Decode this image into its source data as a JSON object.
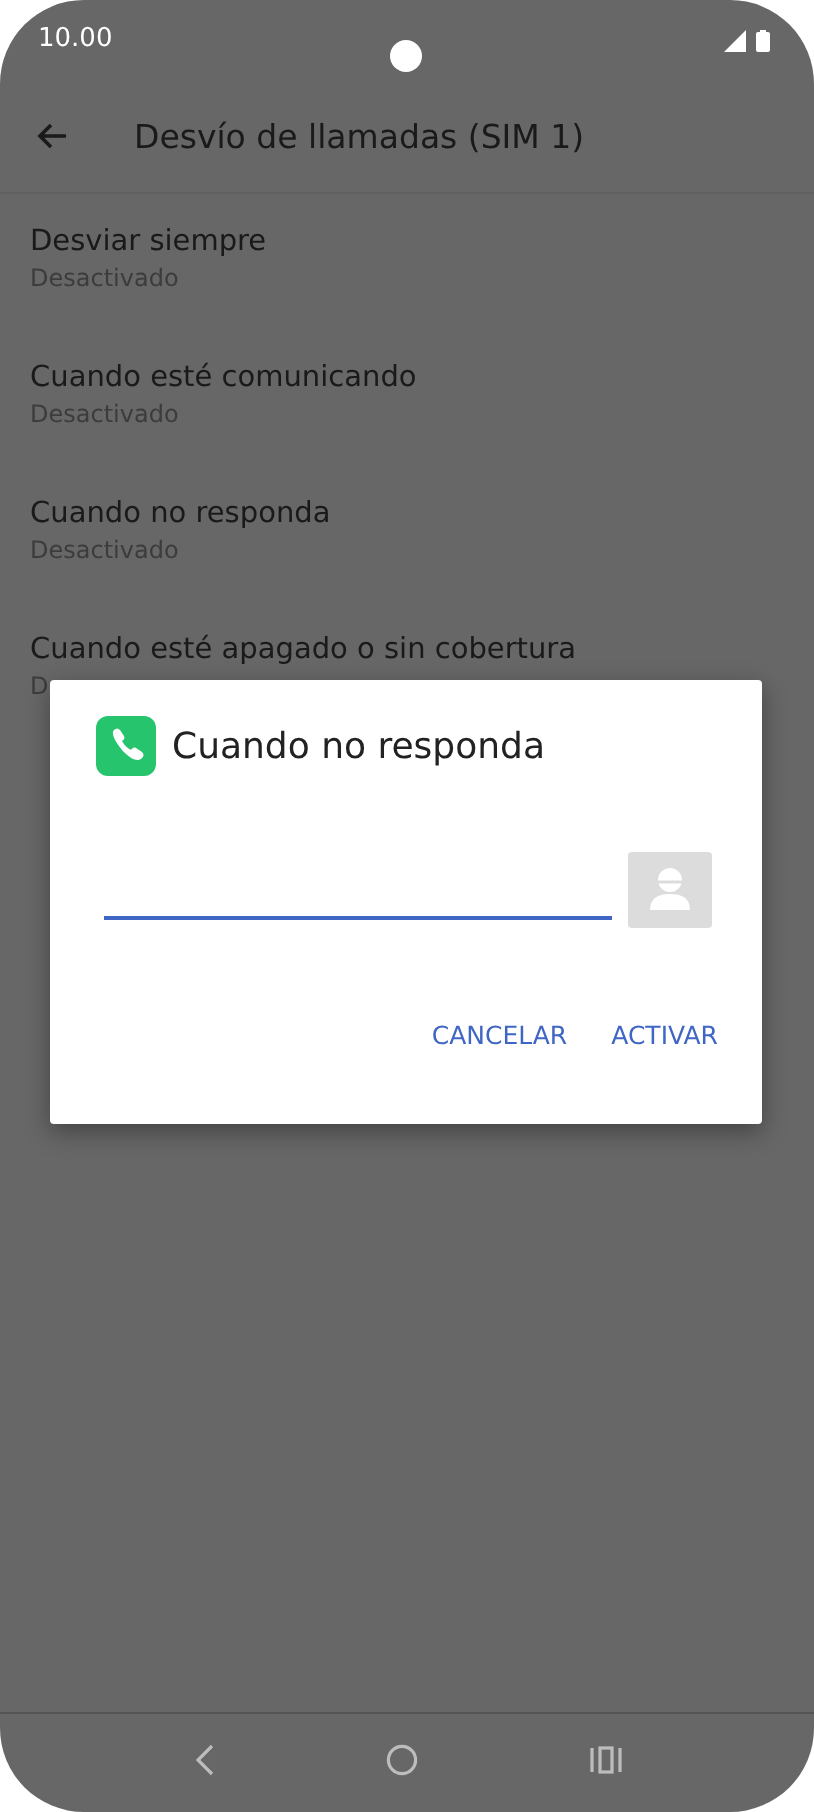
{
  "status_bar": {
    "time": "10.00"
  },
  "toolbar": {
    "title": "Desvío de llamadas (SIM 1)"
  },
  "items": [
    {
      "title": "Desviar siempre",
      "subtitle": "Desactivado"
    },
    {
      "title": "Cuando esté comunicando",
      "subtitle": "Desactivado"
    },
    {
      "title": "Cuando no responda",
      "subtitle": "Desactivado"
    },
    {
      "title": "Cuando esté apagado o sin cobertura",
      "subtitle": "D"
    }
  ],
  "dialog": {
    "title": "Cuando no responda",
    "buttons": [
      "CANCELAR",
      "ACTIVAR"
    ]
  }
}
